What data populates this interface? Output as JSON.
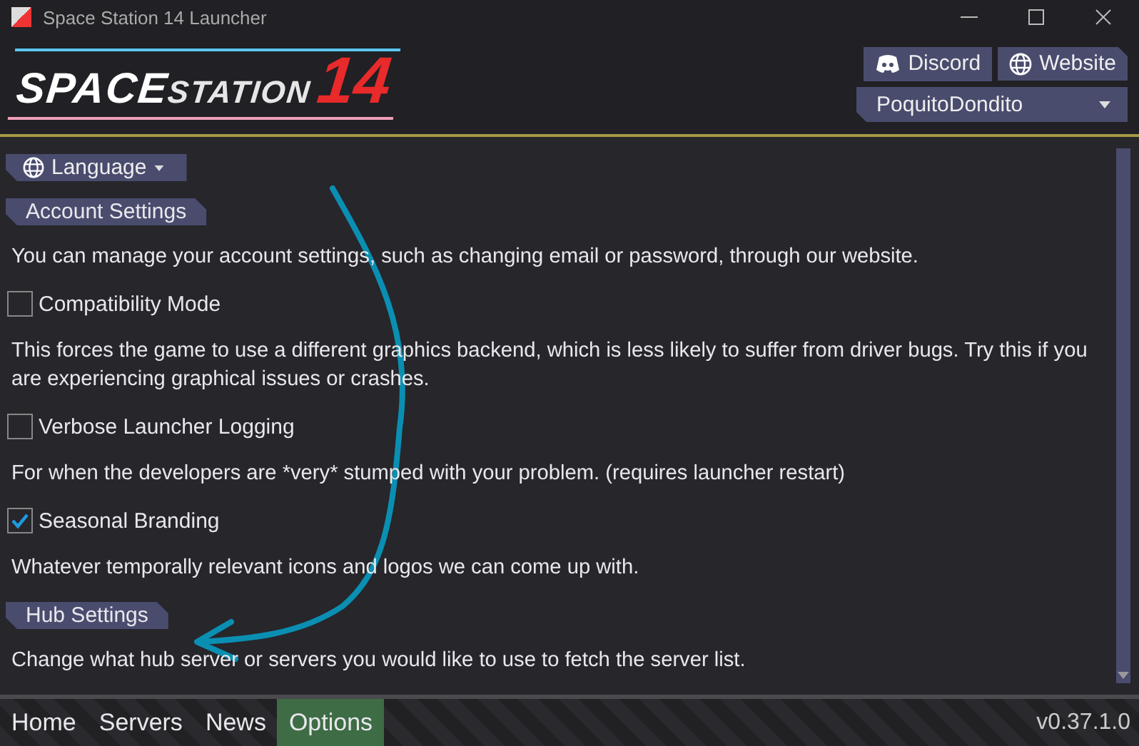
{
  "window": {
    "title": "Space Station 14 Launcher"
  },
  "logo": {
    "word_1": "SPACE",
    "word_2": "STATION",
    "number": "14"
  },
  "header_buttons": [
    {
      "label": "Discord",
      "kind": "discord"
    },
    {
      "label": "Website",
      "kind": "globe"
    }
  ],
  "account_dropdown": {
    "value": "PoquitoDondito"
  },
  "options": [
    {
      "kind": "dropdown",
      "label": "Language"
    },
    {
      "kind": "section",
      "label": "Account Settings"
    },
    {
      "kind": "text",
      "text": "You can manage your account settings, such as changing email or password, through our website."
    },
    {
      "kind": "checkbox",
      "label": "Compatibility Mode",
      "checked": false
    },
    {
      "kind": "text",
      "text": "This forces the game to use a different graphics backend, which is less likely to suffer from driver bugs. Try this if you are experiencing graphical issues or crashes."
    },
    {
      "kind": "checkbox",
      "label": "Verbose Launcher Logging",
      "checked": false
    },
    {
      "kind": "text",
      "text": "For when the developers are *very* stumped with your problem. (requires launcher restart)"
    },
    {
      "kind": "checkbox",
      "label": "Seasonal Branding",
      "checked": true
    },
    {
      "kind": "text",
      "text": "Whatever temporally relevant icons and logos we can come up with."
    },
    {
      "kind": "section",
      "label": "Hub Settings"
    },
    {
      "kind": "text",
      "text": "Change what hub server or servers you would like to use to fetch the server list."
    }
  ],
  "nav_tabs": [
    {
      "label": "Home",
      "selected": false
    },
    {
      "label": "Servers",
      "selected": false
    },
    {
      "label": "News",
      "selected": false
    },
    {
      "label": "Options",
      "selected": true
    }
  ],
  "version": "v0.37.1.0"
}
